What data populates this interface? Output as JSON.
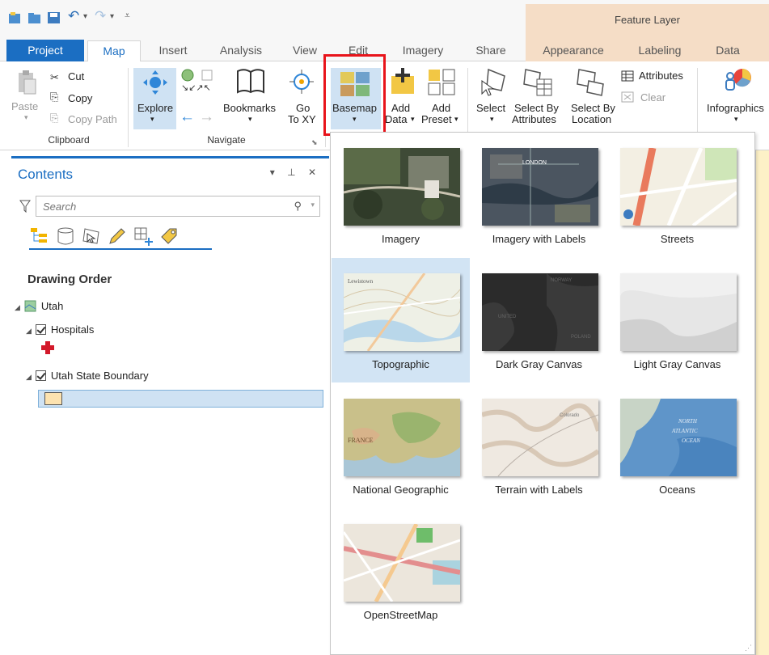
{
  "contextual": {
    "header": "Feature Layer"
  },
  "tabs": [
    {
      "label": "Project"
    },
    {
      "label": "Map"
    },
    {
      "label": "Insert"
    },
    {
      "label": "Analysis"
    },
    {
      "label": "View"
    },
    {
      "label": "Edit"
    },
    {
      "label": "Imagery"
    },
    {
      "label": "Share"
    },
    {
      "label": "Appearance"
    },
    {
      "label": "Labeling"
    },
    {
      "label": "Data"
    }
  ],
  "ribbon": {
    "clipboard": {
      "paste": "Paste",
      "cut": "Cut",
      "copy": "Copy",
      "copy_path": "Copy Path",
      "group": "Clipboard"
    },
    "navigate": {
      "explore": "Explore",
      "bookmarks": "Bookmarks",
      "go": "Go",
      "to_xy": "To XY",
      "group": "Navigate"
    },
    "layer": {
      "basemap": "Basemap",
      "add": "Add",
      "data": "Data",
      "add2": "Add",
      "preset": "Preset"
    },
    "selection": {
      "select": "Select",
      "select_by": "Select By",
      "attributes": "Attributes",
      "select_by2": "Select By",
      "location": "Location",
      "attributes_btn": "Attributes",
      "clear": "Clear"
    },
    "infographics": "Infographics"
  },
  "contents": {
    "title": "Contents",
    "controls": "▾ ⊥ ✕",
    "search_placeholder": "Search",
    "drawing_order": "Drawing Order",
    "tree": {
      "map": "Utah",
      "layer1": "Hospitals",
      "layer2": "Utah State Boundary"
    }
  },
  "basemaps": [
    {
      "label": "Imagery"
    },
    {
      "label": "Imagery with Labels"
    },
    {
      "label": "Streets"
    },
    {
      "label": "Topographic"
    },
    {
      "label": "Dark Gray Canvas"
    },
    {
      "label": "Light Gray Canvas"
    },
    {
      "label": "National Geographic"
    },
    {
      "label": "Terrain with Labels"
    },
    {
      "label": "Oceans"
    },
    {
      "label": "OpenStreetMap"
    }
  ],
  "colors": {
    "accent": "#1b6ec2",
    "highlight": "#e8141b",
    "contextual": "#f5ddc6"
  }
}
